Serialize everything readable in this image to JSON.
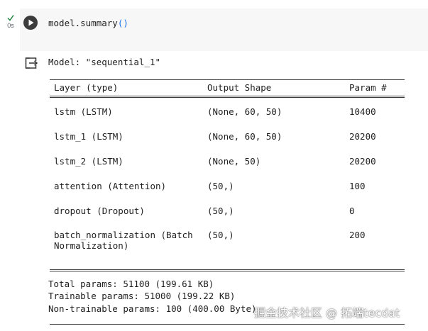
{
  "cell": {
    "exec_time": "0s",
    "code_prefix": "model.summary",
    "code_parens": "()"
  },
  "output": {
    "model_title": "Model: \"sequential_1\"",
    "headers": {
      "layer": "Layer (type)",
      "shape": "Output Shape",
      "param": "Param #"
    },
    "rows": [
      {
        "layer": "lstm (LSTM)",
        "layer_sub": "",
        "shape": "(None, 60, 50)",
        "param": "10400"
      },
      {
        "layer": "lstm_1 (LSTM)",
        "layer_sub": "",
        "shape": "(None, 60, 50)",
        "param": "20200"
      },
      {
        "layer": "lstm_2 (LSTM)",
        "layer_sub": "",
        "shape": "(None, 50)",
        "param": "20200"
      },
      {
        "layer": "attention (Attention)",
        "layer_sub": "",
        "shape": "(50,)",
        "param": "100"
      },
      {
        "layer": "dropout (Dropout)",
        "layer_sub": "",
        "shape": "(50,)",
        "param": "0"
      },
      {
        "layer": "batch_normalization (Batch",
        "layer_sub": "Normalization)",
        "shape": "(50,)",
        "param": "200"
      }
    ],
    "total_params": "Total params: 51100 (199.61 KB)",
    "trainable_params": "Trainable params: 51000 (199.22 KB)",
    "non_trainable_params": "Non-trainable params: 100 (400.00 Byte)"
  },
  "watermark": "掘金技术社区 @ 拓端tecdat",
  "colors": {
    "cell_background": "#f7f7f7",
    "check_green": "#188038",
    "paren_blue": "#1a73e8",
    "run_button": "#3c3c3c"
  },
  "icons": {
    "status": "check-icon",
    "run": "play-icon",
    "output": "output-exit-icon"
  }
}
